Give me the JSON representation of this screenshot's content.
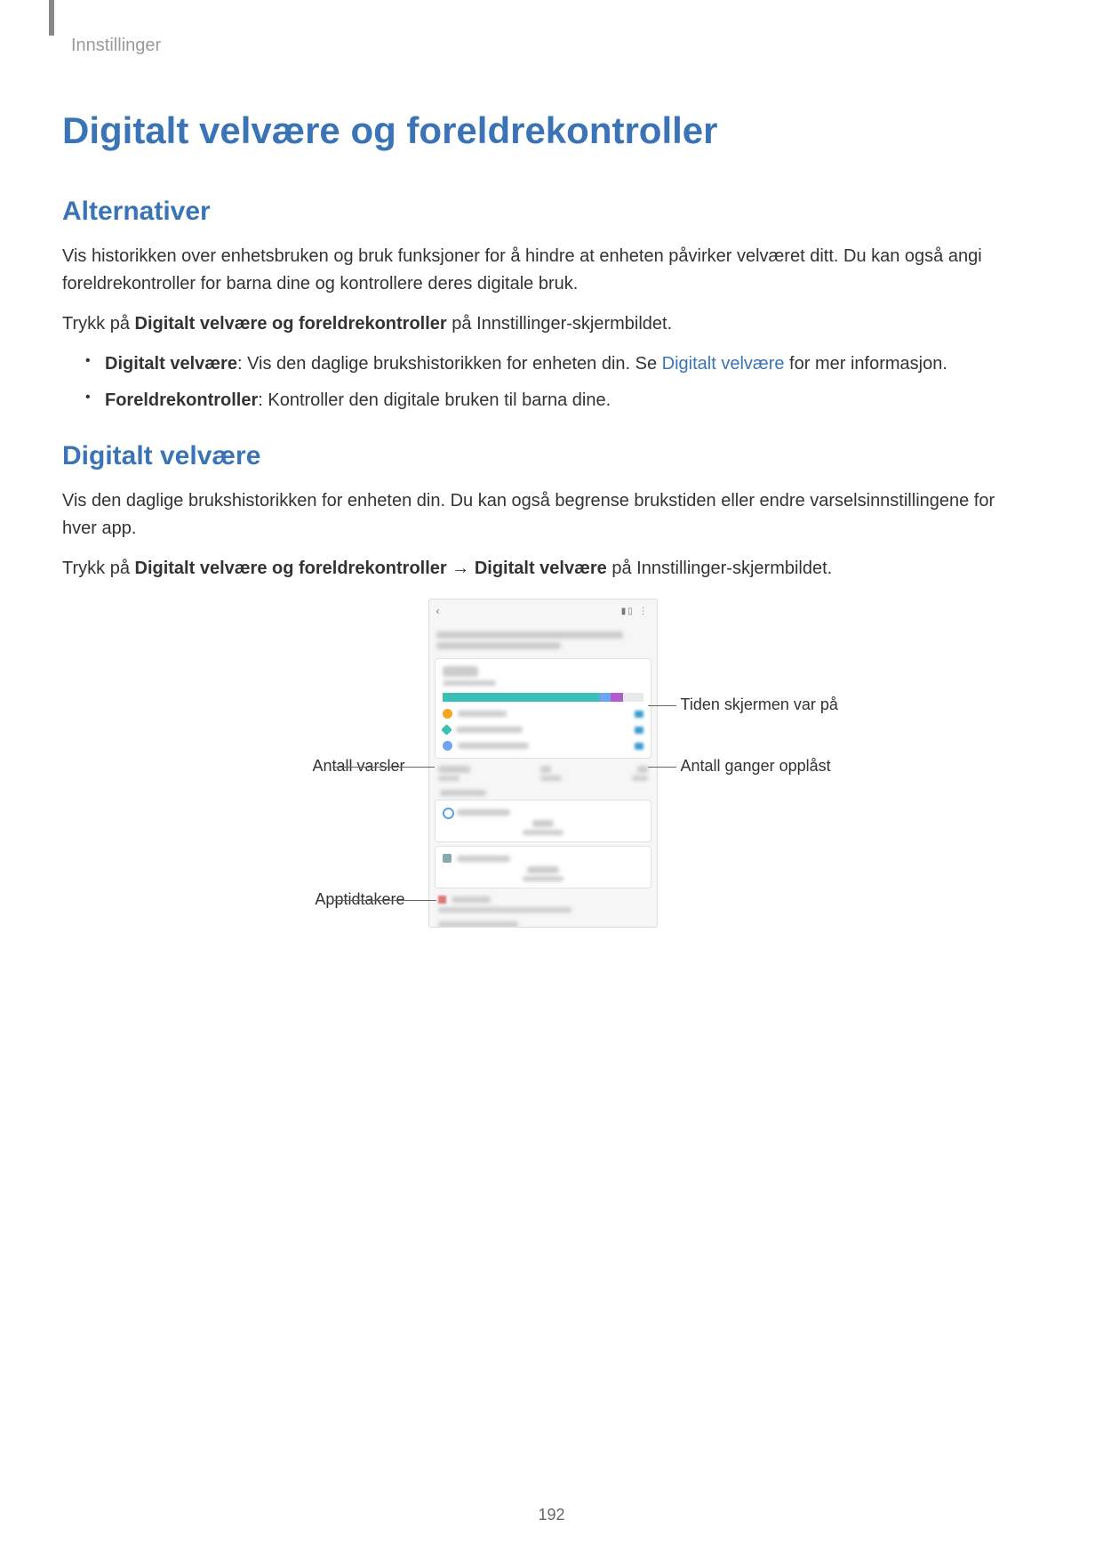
{
  "header": {
    "breadcrumb": "Innstillinger"
  },
  "main_title": "Digitalt velvære og foreldrekontroller",
  "section1": {
    "heading": "Alternativer",
    "p1": "Vis historikken over enhetsbruken og bruk funksjoner for å hindre at enheten påvirker velværet ditt. Du kan også angi foreldrekontroller for barna dine og kontrollere deres digitale bruk.",
    "p2_before": "Trykk på ",
    "p2_bold": "Digitalt velvære og foreldrekontroller",
    "p2_after": " på Innstillinger-skjermbildet.",
    "bullets": {
      "b1_bold": "Digitalt velvære",
      "b1_text1": ": Vis den daglige brukshistorikken for enheten din. Se ",
      "b1_link": "Digitalt velvære",
      "b1_text2": " for mer informasjon.",
      "b2_bold": "Foreldrekontroller",
      "b2_text": ": Kontroller den digitale bruken til barna dine."
    }
  },
  "section2": {
    "heading": "Digitalt velvære",
    "p1": "Vis den daglige brukshistorikken for enheten din. Du kan også begrense brukstiden eller endre varselsinnstillingene for hver app.",
    "p2_before": "Trykk på ",
    "p2_bold1": "Digitalt velvære og foreldrekontroller",
    "p2_arrow": " → ",
    "p2_bold2": "Digitalt velvære",
    "p2_after": " på Innstillinger-skjermbildet."
  },
  "callouts": {
    "left_top": "Antall varsler",
    "left_bottom": "Apptidtakere",
    "right_top": "Tiden skjermen var på",
    "right_bottom": "Antall ganger opplåst"
  },
  "page_number": "192"
}
